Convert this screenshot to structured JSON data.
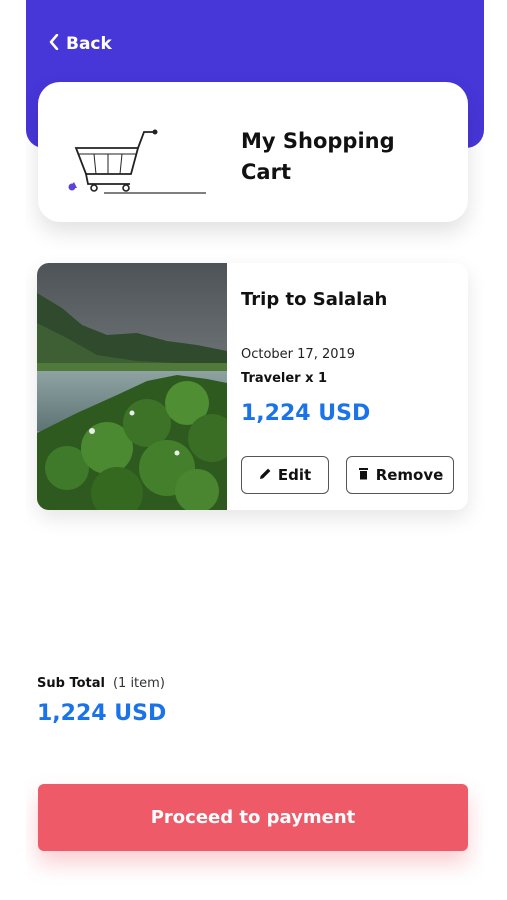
{
  "header": {
    "back_label": "Back",
    "accent_color": "#4736d8"
  },
  "cart_card": {
    "title_line1": "My Shopping",
    "title_line2": "Cart",
    "illustration": "shopping-cart-icon"
  },
  "item": {
    "title": "Trip to Salalah",
    "date": "October 17, 2019",
    "travelers": "Traveler x 1",
    "price": "1,224 USD",
    "image": "landscape-photo",
    "edit_label": "Edit",
    "edit_icon": "pencil-icon",
    "remove_label": "Remove",
    "remove_icon": "trash-icon"
  },
  "summary": {
    "subtotal_label": "Sub Total",
    "item_count": "(1 item)",
    "subtotal_value": "1,224 USD"
  },
  "footer": {
    "pay_label": "Proceed to payment",
    "pay_color": "#ee5a68"
  },
  "colors": {
    "price_blue": "#1a73e8"
  }
}
